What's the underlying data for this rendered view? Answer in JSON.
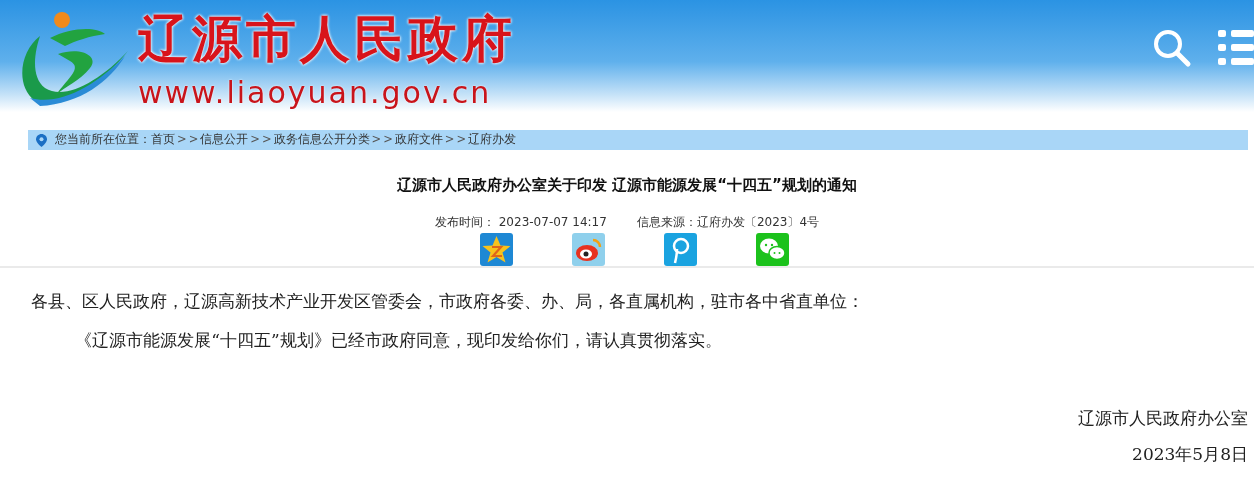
{
  "header": {
    "site_name": "辽源市人民政府",
    "site_url": "www.liaoyuan.gov.cn"
  },
  "breadcrumb": {
    "label": "您当前所在位置：",
    "items": [
      {
        "kind": "link",
        "text": "首页"
      },
      {
        "kind": "separator",
        "text": ">>"
      },
      {
        "kind": "link",
        "text": "信息公开"
      },
      {
        "kind": "separator",
        "text": ">>"
      },
      {
        "kind": "link",
        "text": "政务信息公开分类"
      },
      {
        "kind": "separator",
        "text": ">>"
      },
      {
        "kind": "link",
        "text": "政府文件"
      },
      {
        "kind": "separator",
        "text": ">>"
      },
      {
        "kind": "link",
        "text": "辽府办发"
      }
    ]
  },
  "article": {
    "title": "辽源市人民政府办公室关于印发 辽源市能源发展“十四五”规划的通知",
    "published_label": "发布时间：",
    "published": "2023-07-07 14:17",
    "source_label": "信息来源：",
    "source": "辽府办发〔2023〕4号",
    "share": [
      {
        "kind": "qzone"
      },
      {
        "kind": "weibo"
      },
      {
        "kind": "tencent"
      },
      {
        "kind": "wechat"
      }
    ],
    "paragraphs": [
      {
        "kind": "salutation",
        "text": "各县、区人民政府，辽源高新技术产业开发区管委会，市政府各委、办、局，各直属机构，驻市各中省直单位："
      },
      {
        "kind": "indented",
        "text": "《辽源市能源发展“十四五”规划》已经市政府同意，现印发给你们，请认真贯彻落实。"
      }
    ],
    "signature": "辽源市人民政府办公室",
    "date": "2023年5月8日"
  }
}
